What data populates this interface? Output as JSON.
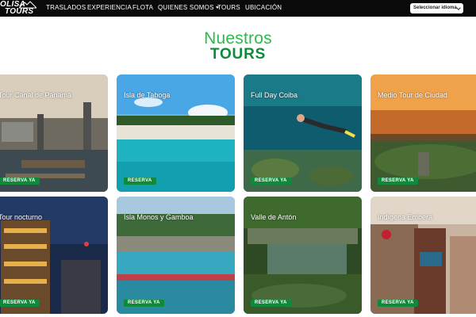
{
  "brand": {
    "logo_line1": "OLISA",
    "logo_line2": "TOURS"
  },
  "nav": {
    "items": [
      {
        "label": "TRASLADOS"
      },
      {
        "label": "EXPERIENCIA"
      },
      {
        "label": "FLOTA"
      },
      {
        "label": "QUIENES SOMOS"
      },
      {
        "label": "TOURS"
      },
      {
        "label": "UBICACIÓN"
      }
    ],
    "language_select": "Seleccionar idioma"
  },
  "heading": {
    "line1": "Nuestros",
    "line2": "TOURS"
  },
  "tours": [
    {
      "title": "Tour Canal de Panamá",
      "button": "RESERVA YA"
    },
    {
      "title": "Isla de Taboga",
      "button": "RESERVA"
    },
    {
      "title": "Full Day Coiba",
      "button": "RESERVA YA"
    },
    {
      "title": "Medio Tour de Ciudad",
      "button": "RESERVA YA"
    },
    {
      "title": "Tour nocturno",
      "button": "RESERVA YA"
    },
    {
      "title": "Isla Monos y Gamboa",
      "button": "RESERVA YA"
    },
    {
      "title": "Valle de Antón",
      "button": "RESERVA YA"
    },
    {
      "title": "Indígena Emberá",
      "button": "RESERVA YA"
    }
  ],
  "colors": {
    "navbar": "#0a0a0a",
    "title_light_green": "#2fb84e",
    "title_dark_green": "#0f8a3a",
    "button_green": "#0f8a3a"
  }
}
